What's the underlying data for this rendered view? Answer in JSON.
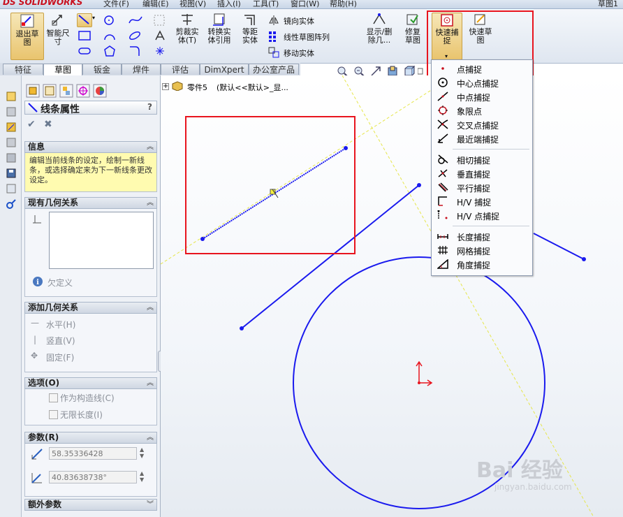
{
  "app": {
    "logo": "SOLIDWORKS",
    "logo_prefix": "DS"
  },
  "menu": [
    "文件(F)",
    "编辑(E)",
    "视图(V)",
    "插入(I)",
    "工具(T)",
    "窗口(W)",
    "帮助(H)"
  ],
  "window_title": "草图1",
  "toolbar": {
    "exit_sketch": "退出草图",
    "smart_dimension": "智能尺寸",
    "trim": "剪裁实体(T)",
    "convert": "转换实体引用",
    "offset": "等距实体",
    "mirror": "镜向实体",
    "linear_pattern": "线性草图阵列",
    "move": "移动实体",
    "display_delete": "显示/删除几...",
    "repair": "修复草图",
    "quick_snap": "快速捕捉",
    "quick_sketch": "快速草图"
  },
  "tabs": [
    "特征",
    "草图",
    "钣金",
    "焊件",
    "评估",
    "DimXpert",
    "办公室产品"
  ],
  "active_tab": "草图",
  "feature_tree": {
    "part": "零件5",
    "config": "(默认<<默认>_显..."
  },
  "property_manager": {
    "title": "线条属性",
    "help": "?",
    "info_title": "信息",
    "info_text": "编辑当前线条的设定，绘制一新线条，或选择确定来为下一新线条更改设定。",
    "existing_relations_title": "现有几何关系",
    "status": "欠定义",
    "add_relations_title": "添加几何关系",
    "relations": [
      "水平(H)",
      "竖直(V)",
      "固定(F)"
    ],
    "options_title": "选项(O)",
    "options": [
      "作为构造线(C)",
      "无限长度(I)"
    ],
    "params_title": "参数(R)",
    "length": "58.35336428",
    "angle": "40.83638738°",
    "extra_title": "额外参数"
  },
  "snap_menu": {
    "group1": [
      "点捕捉",
      "中心点捕捉",
      "中点捕捉",
      "象限点",
      "交叉点捕捉",
      "最近端捕捉"
    ],
    "group2": [
      "相切捕捉",
      "垂直捕捉",
      "平行捕捉",
      "H/V 捕捉",
      "H/V 点捕捉"
    ],
    "group3": [
      "长度捕捉",
      "网格捕捉",
      "角度捕捉"
    ]
  },
  "watermark": {
    "brand": "Bai 经验",
    "url": "jingyan.baidu.com"
  },
  "colors": {
    "accent_red": "#e8141e",
    "sketch_blue": "#1a1aee",
    "highlight": "#f0c860"
  }
}
